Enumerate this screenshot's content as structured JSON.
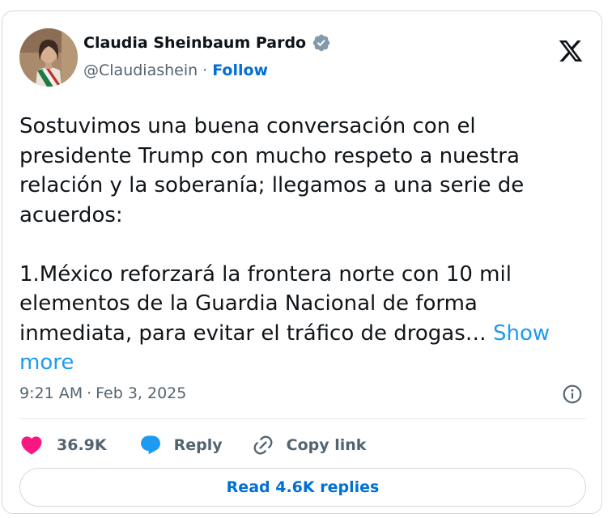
{
  "tweet": {
    "author_name": "Claudia Sheinbaum Pardo",
    "handle": "@Claudiashein",
    "separator": "·",
    "follow_label": "Follow",
    "body": "Sostuvimos una buena conversación con el presidente Trump con mucho respeto a nuestra relación y la soberanía; llegamos a una serie de acuerdos:\n\n1.México reforzará la frontera norte con 10 mil elementos de la Guardia Nacional de forma inmediata, para evitar el tráfico de drogas…",
    "show_more_label": "Show more",
    "time": "9:21 AM",
    "date": "Feb 3, 2025"
  },
  "actions": {
    "like_count": "36.9K",
    "reply_label": "Reply",
    "copy_link_label": "Copy link"
  },
  "read_replies_label": "Read 4.6K replies",
  "icons": {
    "verified": "verified-badge-icon",
    "logo": "x-logo-icon",
    "info": "info-icon",
    "like": "heart-icon",
    "reply": "speech-bubble-icon",
    "copy": "link-icon"
  },
  "colors": {
    "text": "#0f1419",
    "secondary": "#536471",
    "follow": "#006fd6",
    "show_more": "#1d9bf0",
    "like": "#f91880",
    "reply": "#1d9bf0",
    "border": "#cfd9de"
  }
}
